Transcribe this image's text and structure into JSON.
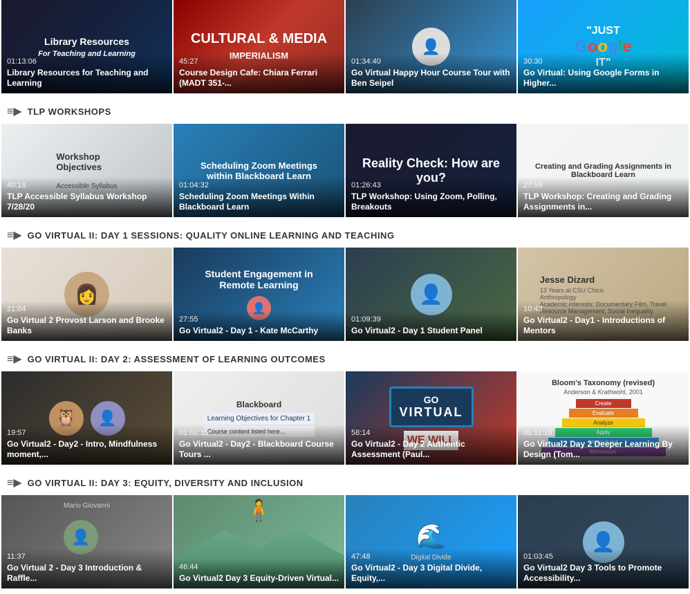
{
  "sections": [
    {
      "id": "library",
      "showHeader": false,
      "videos": [
        {
          "id": "lib-resources",
          "duration": "01:13:06",
          "title": "Library Resources for Teaching and Learning",
          "thumbClass": "thumb-lib",
          "thumbType": "lib"
        },
        {
          "id": "cultural-media",
          "duration": "45:27",
          "title": "Course Design Cafe: Chiara Ferrari (MADT 351-...",
          "thumbClass": "thumb-cultural",
          "thumbType": "cultural"
        },
        {
          "id": "happy-hour",
          "duration": "01:34:40",
          "title": "Go Virtual Happy Hour Course Tour with Ben Seipel",
          "thumbClass": "thumb-happy",
          "thumbType": "person"
        },
        {
          "id": "google-it",
          "duration": "30:30",
          "title": "Go Virtual: Using Google Forms in Higher...",
          "thumbClass": "thumb-google",
          "thumbType": "google"
        }
      ]
    },
    {
      "id": "tlp-workshops",
      "showHeader": true,
      "headerTitle": "TLP WORKSHOPS",
      "videos": [
        {
          "id": "accessible-syllabus",
          "duration": "40:18",
          "title": "TLP Accessible Syllabus Workshop 7/28/20",
          "thumbClass": "thumb-tlp1",
          "thumbType": "tlp1"
        },
        {
          "id": "scheduling-zoom",
          "duration": "01:04:32",
          "title": "Scheduling Zoom Meetings Within Blackboard Learn",
          "thumbClass": "thumb-zoom",
          "thumbType": "zoom"
        },
        {
          "id": "using-zoom",
          "duration": "01:26:43",
          "title": "TLP Workshop: Using Zoom, Polling, Breakouts",
          "thumbClass": "thumb-reality",
          "thumbType": "reality"
        },
        {
          "id": "creating-grading",
          "duration": "27:59",
          "title": "TLP Workshop: Creating and Grading Assignments in...",
          "thumbClass": "thumb-creating",
          "thumbType": "creating"
        }
      ]
    },
    {
      "id": "go-virtual-day1",
      "showHeader": true,
      "headerTitle": "GO VIRTUAL II: DAY 1 SESSIONS: QUALITY ONLINE LEARNING AND TEACHING",
      "videos": [
        {
          "id": "provost-larson",
          "duration": "21:04",
          "title": "Go Virtual 2 Provost Larson and Brooke Banks",
          "thumbClass": "thumb-provost",
          "thumbType": "provost"
        },
        {
          "id": "kate-mccarthy",
          "duration": "27:55",
          "title": "Go Virtual2 - Day 1 - Kate McCarthy",
          "thumbClass": "thumb-kate",
          "thumbType": "kate"
        },
        {
          "id": "student-panel",
          "duration": "01:09:39",
          "title": "Go Virtual2 - Day 1 Student Panel",
          "thumbClass": "thumb-student",
          "thumbType": "student"
        },
        {
          "id": "jesse-dizard",
          "duration": "10:43",
          "title": "Go Virtual2 - Day1 - Introductions of Mentors",
          "thumbClass": "thumb-jesse",
          "thumbType": "jesse"
        }
      ]
    },
    {
      "id": "go-virtual-day2",
      "showHeader": true,
      "headerTitle": "GO VIRTUAL II: DAY 2: ASSESSMENT OF LEARNING OUTCOMES",
      "videos": [
        {
          "id": "day2-intro",
          "duration": "19:57",
          "title": "Go Virtual2 - Day2 - Intro, Mindfulness moment,...",
          "thumbClass": "thumb-day2intro",
          "thumbType": "day2intro"
        },
        {
          "id": "day2-blackboard",
          "duration": "01:02:15",
          "title": "Go Virtual2 - Day2 - Blackboard Course Tours ...",
          "thumbClass": "thumb-blackboard",
          "thumbType": "blackboard"
        },
        {
          "id": "day2-authentic",
          "duration": "58:14",
          "title": "Go Virtual2 - Day 2 Authentic Assessment (Paul...",
          "thumbClass": "thumb-authentic",
          "thumbType": "authentic"
        },
        {
          "id": "day2-bloom",
          "duration": "01:11:18",
          "title": "Go Virtual2 Day 2 Deeper Learning By Design (Tom...",
          "thumbClass": "thumb-bloom",
          "thumbType": "bloom"
        }
      ]
    },
    {
      "id": "go-virtual-day3",
      "showHeader": true,
      "headerTitle": "GO VIRTUAL II: DAY 3: EQUITY, DIVERSITY AND INCLUSION",
      "videos": [
        {
          "id": "day3-intro",
          "duration": "11:37",
          "title": "Go Virtual 2 - Day 3 Introduction & Raffle...",
          "thumbClass": "thumb-day3intro",
          "thumbType": "day3intro"
        },
        {
          "id": "day3-equity",
          "duration": "46:44",
          "title": "Go Virtual2 Day 3 Equity-Driven Virtual...",
          "thumbClass": "thumb-equity",
          "thumbType": "equity"
        },
        {
          "id": "day3-digital",
          "duration": "47:48",
          "title": "Go Virtual2 - Day 3 Digital Divide, Equity,...",
          "thumbClass": "thumb-digital",
          "thumbType": "digital"
        },
        {
          "id": "day3-tools",
          "duration": "01:03:45",
          "title": "Go Virtual2 Day 3 Tools to Promote Accessibility...",
          "thumbClass": "thumb-tools",
          "thumbType": "tools"
        }
      ]
    }
  ],
  "icons": {
    "playlist": "≡▶"
  }
}
